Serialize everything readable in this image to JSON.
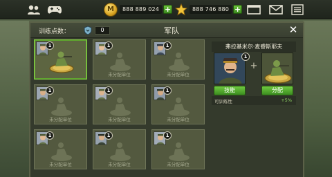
{
  "topbar": {
    "profile_icon": "users-icon",
    "gamepad_icon": "gamepad-icon",
    "coins": {
      "icon_letter": "M",
      "value": "888 889 024",
      "plus_label": "+"
    },
    "stars": {
      "value": "888 746 880",
      "plus_label": "+"
    },
    "shop_icon": "shop-icon",
    "mail_icon": "mail-icon",
    "menu_icon": "menu-icon"
  },
  "panel": {
    "points_label": "训练点数：",
    "points_value": "0",
    "title": "军队",
    "close_label": "✕"
  },
  "slots": [
    {
      "badge": "1",
      "label": "",
      "filled": true,
      "selected": true
    },
    {
      "badge": "1",
      "label": "未分配单位",
      "filled": false,
      "selected": false
    },
    {
      "badge": "1",
      "label": "未分配单位",
      "filled": false,
      "selected": false
    },
    {
      "badge": "1",
      "label": "未分配单位",
      "filled": false,
      "selected": false
    },
    {
      "badge": "1",
      "label": "未分配单位",
      "filled": false,
      "selected": false
    },
    {
      "badge": "1",
      "label": "未分配单位",
      "filled": false,
      "selected": false
    },
    {
      "badge": "1",
      "label": "未分配单位",
      "filled": false,
      "selected": false
    },
    {
      "badge": "1",
      "label": "未分配单位",
      "filled": false,
      "selected": false
    },
    {
      "badge": "1",
      "label": "未分配单位",
      "filled": false,
      "selected": false
    }
  ],
  "detail": {
    "name": "弗拉基米尔·麦睿斯耶夫",
    "hero_badge": "1",
    "plus_sign": "+",
    "skill_button": "技能",
    "assign_button": "分配",
    "stat_label": "可训练性",
    "stat_value": "+5%"
  },
  "colors": {
    "accent_green": "#6fc940",
    "panel_bg": "#343a2c",
    "slot_bg": "#53593f",
    "selected_border": "#8bd14a"
  }
}
